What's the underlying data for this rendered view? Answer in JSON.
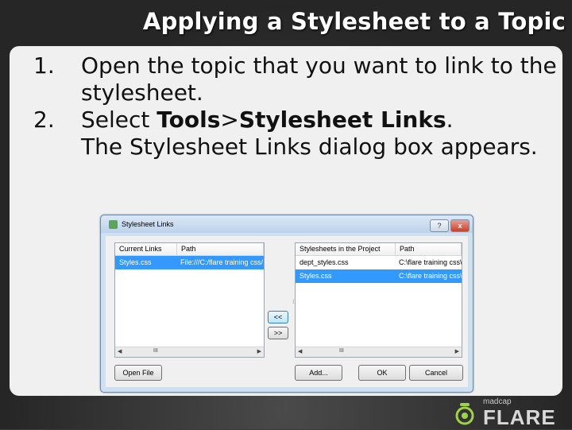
{
  "slide": {
    "title": "Applying a Stylesheet to a Topic",
    "steps": [
      {
        "num": "1.",
        "text": "Open the topic that you want to link to the stylesheet."
      },
      {
        "num": "2.",
        "prefix": "Select ",
        "bold1": "Tools",
        "sep": ">",
        "bold2": "Stylesheet Links",
        "suffix": "."
      }
    ],
    "note": "The Stylesheet Links dialog box appears."
  },
  "dialog": {
    "title": "Stylesheet Links",
    "help_label": "?",
    "close_label": "x",
    "left_list": {
      "headers": [
        "Current Links",
        "Path"
      ],
      "rows": [
        {
          "name": "Styles.css",
          "path": "File:///C:/flare training css/",
          "selected": true
        }
      ]
    },
    "right_list": {
      "headers": [
        "Stylesheets in the Project",
        "Path"
      ],
      "rows": [
        {
          "name": "dept_styles.css",
          "path": "C:\\flare training css\\",
          "selected": false
        },
        {
          "name": "Styles.css",
          "path": "C:\\flare training css\\",
          "selected": true
        }
      ]
    },
    "scroll_grip": "III",
    "move_left_label": "<<",
    "move_right_label": ">>",
    "buttons": {
      "open_file": "Open File",
      "add": "Add...",
      "ok": "OK",
      "cancel": "Cancel"
    }
  },
  "logo": {
    "company": "madcap",
    "product": "FLARE"
  }
}
